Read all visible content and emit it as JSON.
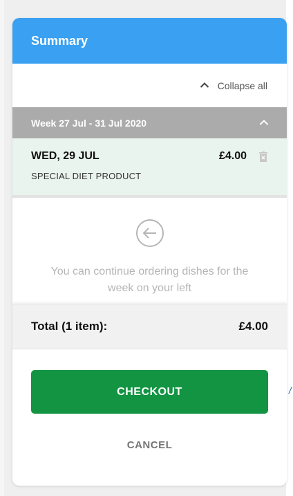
{
  "summary": {
    "title": "Summary",
    "collapse_label": "Collapse all",
    "week": {
      "label": "Week 27 Jul - 31 Jul 2020",
      "items": [
        {
          "day": "WED, 29 JUL",
          "price": "£4.00",
          "product": "SPECIAL DIET PRODUCT"
        }
      ]
    },
    "hint": "You can continue ordering dishes for the week on your left",
    "total_label": "Total (1 item):",
    "total_value": "£4.00",
    "checkout_label": "CHECKOUT",
    "cancel_label": "CANCEL"
  },
  "icons": {
    "collapse": "chevron-up-icon",
    "week_toggle": "chevron-up-icon",
    "remove": "trash-icon",
    "hint": "arrow-left-circle-icon"
  },
  "colors": {
    "header": "#3aa0f2",
    "week_bar": "#ababab",
    "item_bg": "#eaf4ee",
    "checkout": "#129442",
    "hint_text": "#b5b5b5"
  }
}
